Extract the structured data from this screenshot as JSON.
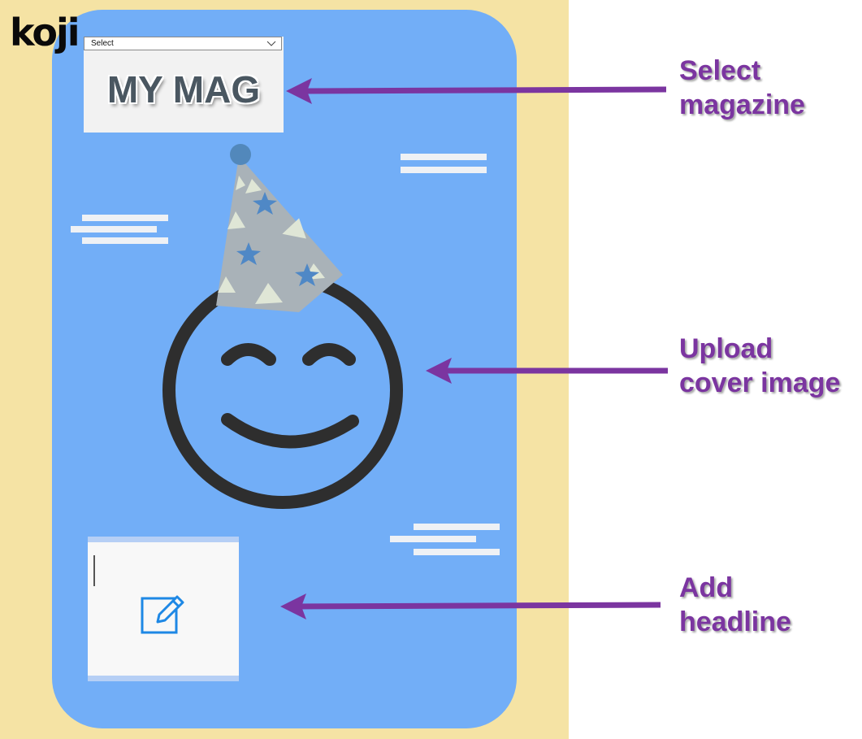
{
  "brand": {
    "logo_text": "koji"
  },
  "magazine": {
    "select_value": "Select",
    "title": "MY MAG"
  },
  "cover": {
    "background_color": "#72aef7",
    "frame_color": "#f5e3a4",
    "image_icon": "party-hat-smiley-icon"
  },
  "headline_editor": {
    "icon": "edit-icon",
    "value": ""
  },
  "annotations": [
    {
      "id": "select-magazine",
      "lines": [
        "Select",
        "magazine"
      ]
    },
    {
      "id": "upload-cover-image",
      "lines": [
        "Upload",
        "cover image"
      ]
    },
    {
      "id": "add-headline",
      "lines": [
        "Add",
        "headline"
      ]
    }
  ],
  "colors": {
    "annotation": "#7b35a0",
    "accent_blue": "#1e88e5"
  }
}
